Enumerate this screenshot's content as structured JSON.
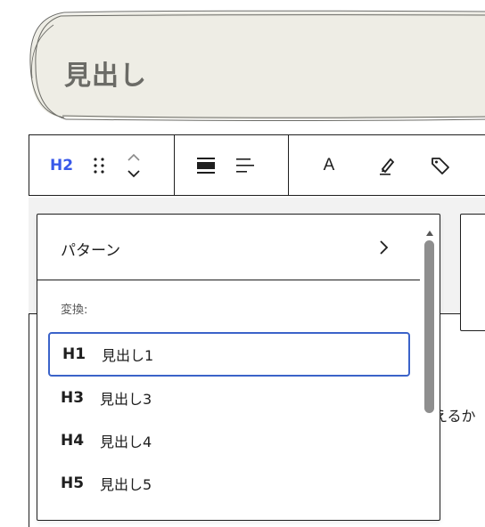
{
  "heading": {
    "text": "見出し"
  },
  "toolbar": {
    "block_type_label": "H2",
    "icons": [
      "drag-handle-icon",
      "move-up-icon",
      "move-down-icon",
      "align-center-icon",
      "align-left-icon",
      "text-color-icon",
      "highlight-pen-icon",
      "tag-icon"
    ],
    "text_color_glyph": "A"
  },
  "dropdown": {
    "pattern_label": "パターン",
    "section_label": "変換:",
    "items": [
      {
        "level": "H1",
        "label": "見出し1",
        "selected": true
      },
      {
        "level": "H3",
        "label": "見出し3",
        "selected": false
      },
      {
        "level": "H4",
        "label": "見出し4",
        "selected": false
      },
      {
        "level": "H5",
        "label": "見出し5",
        "selected": false
      }
    ]
  },
  "background_text": {
    "partial": "えるか"
  },
  "colors": {
    "accent": "#3858e9",
    "selected_border": "#3b63c9",
    "heading_bg": "#eeede5",
    "text": "#1e1e1e"
  }
}
